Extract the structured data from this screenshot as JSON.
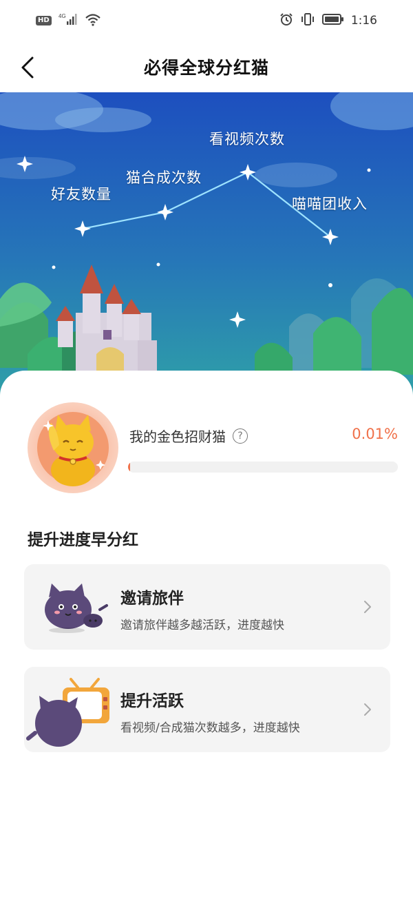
{
  "status_bar": {
    "left_badge": "HD",
    "network": "4G",
    "time": "1:16"
  },
  "header": {
    "title": "必得全球分红猫"
  },
  "hero": {
    "labels": {
      "friends": "好友数量",
      "merge": "猫合成次数",
      "video": "看视频次数",
      "income": "喵喵团收入"
    }
  },
  "cat_progress": {
    "label": "我的金色招财猫",
    "percent_text": "0.01%",
    "progress_fraction": 0.0001
  },
  "section": {
    "title": "提升进度早分红"
  },
  "tasks": [
    {
      "title": "邀请旅伴",
      "description": "邀请旅伴越多越活跃，进度越快",
      "icon": "purple-cat-icon"
    },
    {
      "title": "提升活跃",
      "description": "看视频/合成猫次数越多，进度越快",
      "icon": "tv-cat-icon"
    }
  ],
  "colors": {
    "accent": "#f0714a",
    "hero_sky_top": "#1f55c4",
    "hero_sky_bottom": "#2e93b0"
  }
}
